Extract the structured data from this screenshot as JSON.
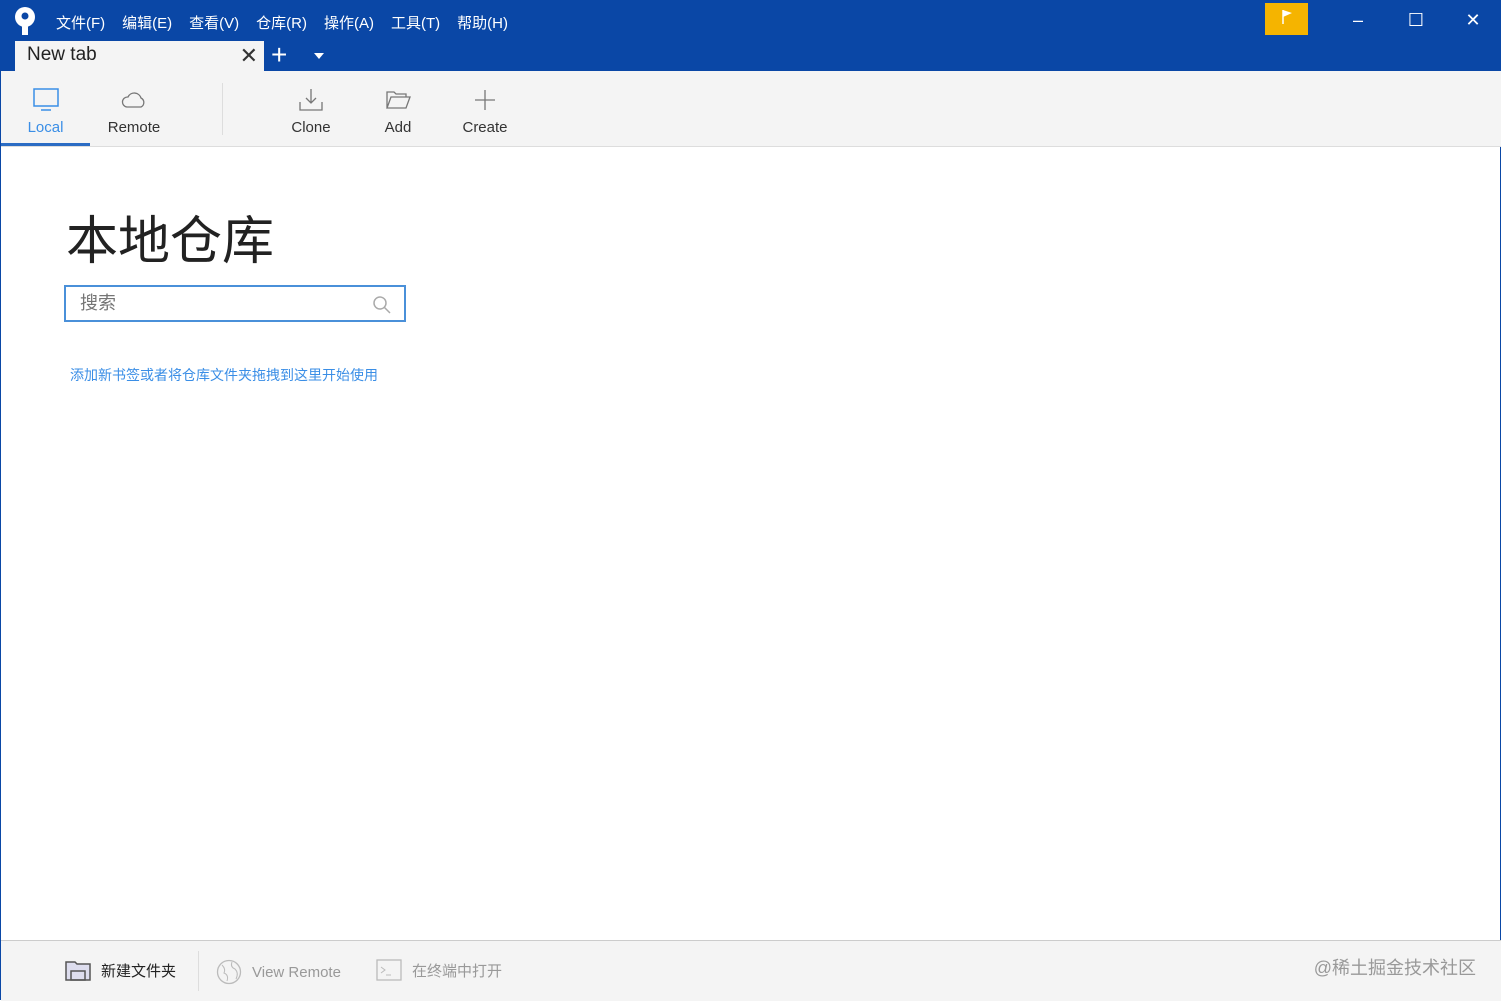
{
  "menu": [
    "文件(F)",
    "编辑(E)",
    "查看(V)",
    "仓库(R)",
    "操作(A)",
    "工具(T)",
    "帮助(H)"
  ],
  "tab": {
    "label": "New tab"
  },
  "toolbar": {
    "local": "Local",
    "remote": "Remote",
    "clone": "Clone",
    "add": "Add",
    "create": "Create"
  },
  "main": {
    "title": "本地仓库",
    "search_placeholder": "搜索",
    "hint": "添加新书签或者将仓库文件夹拖拽到这里开始使用"
  },
  "bottom": {
    "new_folder": "新建文件夹",
    "view_remote": "View Remote",
    "open_terminal": "在终端中打开",
    "watermark": "@稀土掘金技术社区"
  }
}
